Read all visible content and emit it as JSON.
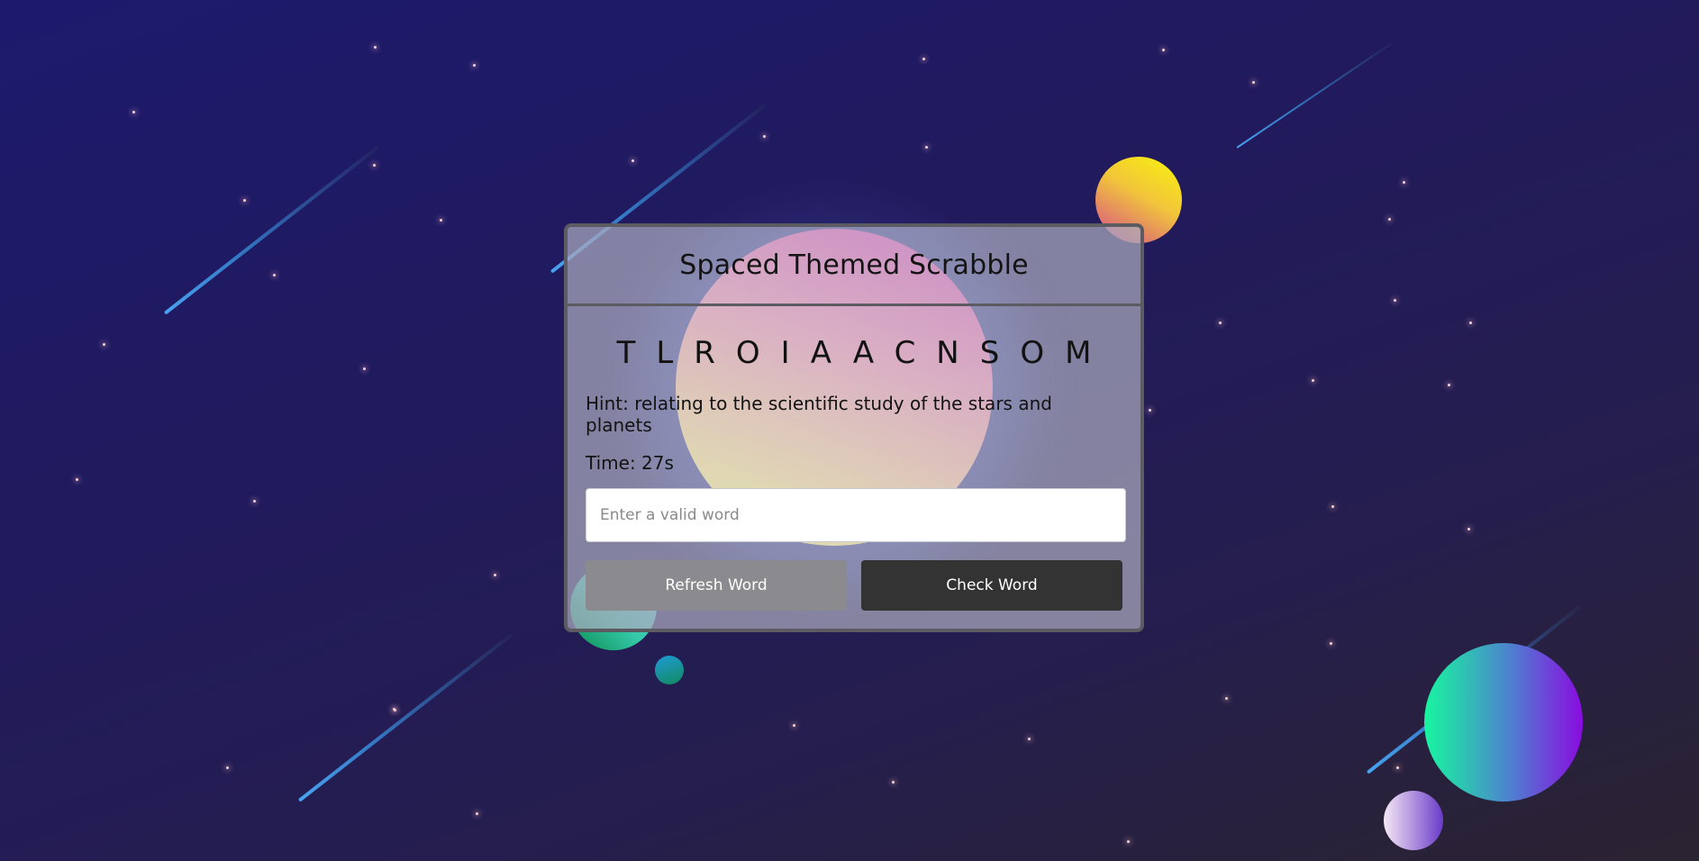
{
  "game": {
    "title": "Spaced Themed Scrabble",
    "scrambled_word": "TLROIAACNSOM",
    "hint": "Hint: relating to the scientific study of the stars and planets",
    "time": "Time: 27s"
  },
  "input": {
    "placeholder": "Enter a valid word",
    "value": ""
  },
  "buttons": {
    "refresh_label": "Refresh Word",
    "check_label": "Check Word"
  },
  "colors": {
    "background": "#1d1a6e",
    "card_border": "#5b5b61",
    "refresh_button": "#8b8a8f",
    "check_button": "#333333",
    "meteor": "#49a3f0"
  }
}
